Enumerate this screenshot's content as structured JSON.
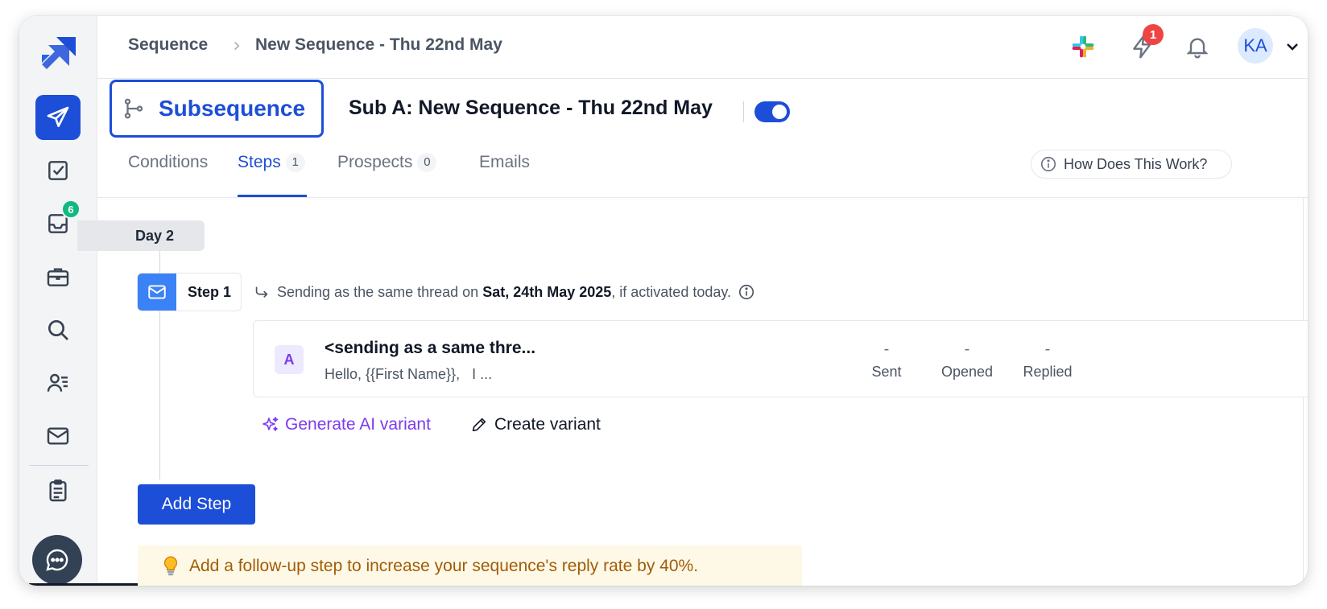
{
  "breadcrumb": {
    "root": "Sequence",
    "current": "New Sequence - Thu 22nd May"
  },
  "topbar": {
    "notifications_count": "1",
    "avatar_initials": "KA"
  },
  "sidebar": {
    "inbox_badge": "6",
    "items": [
      "send-icon",
      "tasks-icon",
      "inbox-icon",
      "briefcase-icon",
      "search-icon",
      "prospects-icon",
      "mail-icon",
      "reports-icon"
    ]
  },
  "header": {
    "subsequence_label": "Subsequence",
    "title": "Sub A: New Sequence - Thu 22nd May",
    "toggle_on": true
  },
  "tabs": [
    {
      "label": "Conditions",
      "count": null
    },
    {
      "label": "Steps",
      "count": "1"
    },
    {
      "label": "Prospects",
      "count": "0"
    },
    {
      "label": "Emails",
      "count": null
    }
  ],
  "help_button": "How Does This Work?",
  "day_label": "Day 2",
  "step": {
    "label": "Step 1",
    "send_prefix": "Sending as the same thread on ",
    "send_date": "Sat, 24th May 2025",
    "send_suffix": ", if activated today."
  },
  "email": {
    "variant": "A",
    "subject": "<sending as a same thre...",
    "preview": "Hello, {{First Name}},   I ...",
    "stats": [
      {
        "value": "-",
        "label": "Sent"
      },
      {
        "value": "-",
        "label": "Opened"
      },
      {
        "value": "-",
        "label": "Replied"
      }
    ]
  },
  "actions": {
    "generate_ai": "Generate AI variant",
    "create_variant": "Create variant",
    "add_step": "Add Step"
  },
  "tip": "Add a follow-up step to increase your sequence's reply rate by 40%.",
  "colors": {
    "primary": "#1d4ed8",
    "ai_purple": "#7c3aed",
    "badge_red": "#ef4444",
    "badge_green": "#10b981",
    "tip_bg": "#fef9e7"
  }
}
